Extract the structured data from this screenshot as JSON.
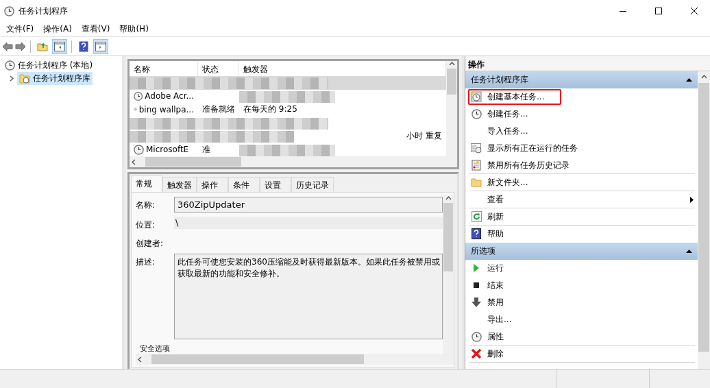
{
  "window": {
    "title": "任务计划程序"
  },
  "menu": [
    "文件(F)",
    "操作(A)",
    "查看(V)",
    "帮助(H)"
  ],
  "tree": [
    {
      "label": "任务计划程序 (本地)",
      "selected": false,
      "expanded": true,
      "children": [
        {
          "label": "任务计划程序库",
          "selected": true,
          "expanded": false
        }
      ]
    }
  ],
  "task_list": {
    "columns": [
      "名称",
      "状态",
      "触发器"
    ],
    "rows": [
      {
        "selected": true,
        "blurred": true
      },
      {
        "name": "Adobe Acr...",
        "selected": false,
        "blurred": true
      },
      {
        "name": "bing wallpa...",
        "status": "准备就绪",
        "trigger": "在每天的 9:25",
        "selected": false,
        "blurred": false
      },
      {
        "selected": false,
        "blurred": true
      },
      {
        "trigger": "小时 重复",
        "selected": false,
        "blurred": true
      },
      {
        "name": "MicrosoftE",
        "status": "准",
        "selected": false,
        "blurred": true
      }
    ]
  },
  "detail": {
    "tabs": [
      {
        "label": "常规",
        "selected": true
      },
      {
        "label": "触发器",
        "selected": false
      },
      {
        "label": "操作",
        "selected": false
      },
      {
        "label": "条件",
        "selected": false
      },
      {
        "label": "设置",
        "selected": false
      },
      {
        "label": "历史记录",
        "selected": false
      }
    ],
    "fields": [
      {
        "label": "名称:",
        "kind": "input",
        "value": "360ZipUpdater"
      },
      {
        "label": "位置:",
        "kind": "readonly",
        "value": "\\"
      },
      {
        "label": "创建者:",
        "kind": "readonly"
      },
      {
        "label": "描述:",
        "kind": "textarea",
        "lines": [
          "此任务可使您安装的360压缩能及时获得最新版本。如果此任务被禁用或",
          "获取最新的功能和安全修补。"
        ]
      }
    ],
    "group_label": "安全选项"
  },
  "actions": {
    "title": "操作",
    "sections": [
      {
        "title": "任务计划程序库",
        "expanded": true,
        "items": [
          {
            "label": "创建基本任务...",
            "kind": "wizard",
            "highlighted": true,
            "divider_after": false
          },
          {
            "label": "创建任务...",
            "kind": "clock",
            "highlighted": false,
            "divider_after": false
          },
          {
            "label": "导入任务...",
            "kind": "plain",
            "highlighted": false,
            "divider_after": false
          },
          {
            "label": "显示所有正在运行的任务",
            "kind": "list",
            "highlighted": false,
            "divider_after": false
          },
          {
            "label": "禁用所有任务历史记录",
            "kind": "log",
            "highlighted": false,
            "divider_after": true
          },
          {
            "label": "新文件夹...",
            "kind": "folder",
            "highlighted": false,
            "divider_after": true
          },
          {
            "label": "查看",
            "kind": "submenu",
            "highlighted": false,
            "divider_after": true
          },
          {
            "label": "刷新",
            "kind": "refresh",
            "highlighted": false,
            "divider_after": true
          },
          {
            "label": "帮助",
            "kind": "help",
            "highlighted": false,
            "divider_after": false
          }
        ]
      },
      {
        "title": "所选项",
        "expanded": true,
        "items": [
          {
            "label": "运行",
            "kind": "run",
            "highlighted": false,
            "divider_after": false
          },
          {
            "label": "结束",
            "kind": "stop",
            "highlighted": false,
            "divider_after": false
          },
          {
            "label": "禁用",
            "kind": "disable",
            "highlighted": false,
            "divider_after": false
          },
          {
            "label": "导出...",
            "kind": "plain",
            "highlighted": false,
            "divider_after": false
          },
          {
            "label": "属性",
            "kind": "clock",
            "highlighted": false,
            "divider_after": true
          },
          {
            "label": "删除",
            "kind": "delete",
            "highlighted": false,
            "divider_after": true
          }
        ]
      }
    ]
  }
}
